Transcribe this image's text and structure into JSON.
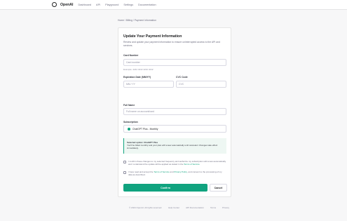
{
  "nav": {
    "brand": "OpenAI",
    "items": [
      "Dashboard",
      "API",
      "Playground",
      "Settings",
      "Documentation"
    ]
  },
  "breadcrumb": "Home / Billing / Payment Information",
  "form": {
    "title": "Update Your Payment Information",
    "description": "Review and update your payment information to ensure uninterrupted access to the API and services.",
    "card_number": {
      "label": "Card Number",
      "placeholder": "Card number",
      "hint": "Example: 4242 4242 4242 4242"
    },
    "expiration": {
      "label": "Expiration Date (MM/YY)",
      "placeholder": "MM / YY"
    },
    "cvc": {
      "label": "CVC Code",
      "placeholder": "CVC"
    },
    "full_name": {
      "label": "Full Name",
      "placeholder": "Full name on account/card"
    },
    "subscription": {
      "label": "Subscription",
      "value": "ChatGPT Plus - Monthly"
    },
    "note": {
      "heading": "Selected option: ChatGPT Plus",
      "body": "You'll be billed monthly and your plan will renew automatically until canceled. Changes take effect immediately."
    },
    "check1": {
      "text": "I confirm these changes to my selected frequency and authorize my subscription will renew automatically and I understand the update will be applied as stated in the",
      "link": "Terms of Service"
    },
    "check2": {
      "prefix": "I have read and accept the",
      "link1": "Terms of Service",
      "middle": "and",
      "link2": "Privacy Policy",
      "suffix": ", and consent to the processing of my data as described."
    },
    "confirm_label": "Confirm",
    "cancel_label": "Cancel"
  },
  "footer": [
    "© 2024 OpenAI. All rights reserved.",
    "Help Center",
    "API Documentation",
    "Terms",
    "Privacy"
  ],
  "colors": {
    "accent": "#10a37f"
  }
}
